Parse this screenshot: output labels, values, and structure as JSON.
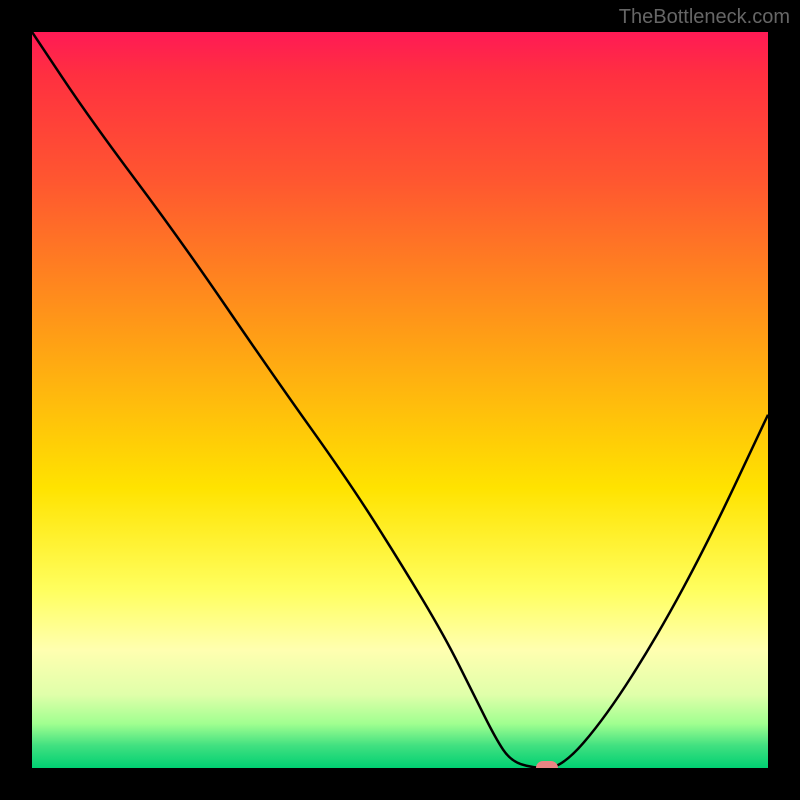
{
  "attribution": "TheBottleneck.com",
  "chart_data": {
    "type": "line",
    "title": "",
    "xlabel": "",
    "ylabel": "",
    "xlim": [
      0,
      100
    ],
    "ylim": [
      0,
      100
    ],
    "x": [
      0,
      8,
      20,
      33,
      43,
      50,
      56,
      60,
      63,
      65,
      68,
      72,
      78,
      85,
      92,
      100
    ],
    "values": [
      100,
      88,
      72,
      53,
      39,
      28,
      18,
      10,
      4,
      1,
      0,
      0,
      7,
      18,
      31,
      48
    ],
    "marker": {
      "x": 70,
      "y": 0
    },
    "gradient_stops": [
      {
        "pos": 0,
        "color": "#ff1a55"
      },
      {
        "pos": 20,
        "color": "#ff5630"
      },
      {
        "pos": 42,
        "color": "#ffa015"
      },
      {
        "pos": 62,
        "color": "#ffe300"
      },
      {
        "pos": 84,
        "color": "#ffffb0"
      },
      {
        "pos": 97,
        "color": "#40e080"
      },
      {
        "pos": 100,
        "color": "#00d072"
      }
    ]
  }
}
